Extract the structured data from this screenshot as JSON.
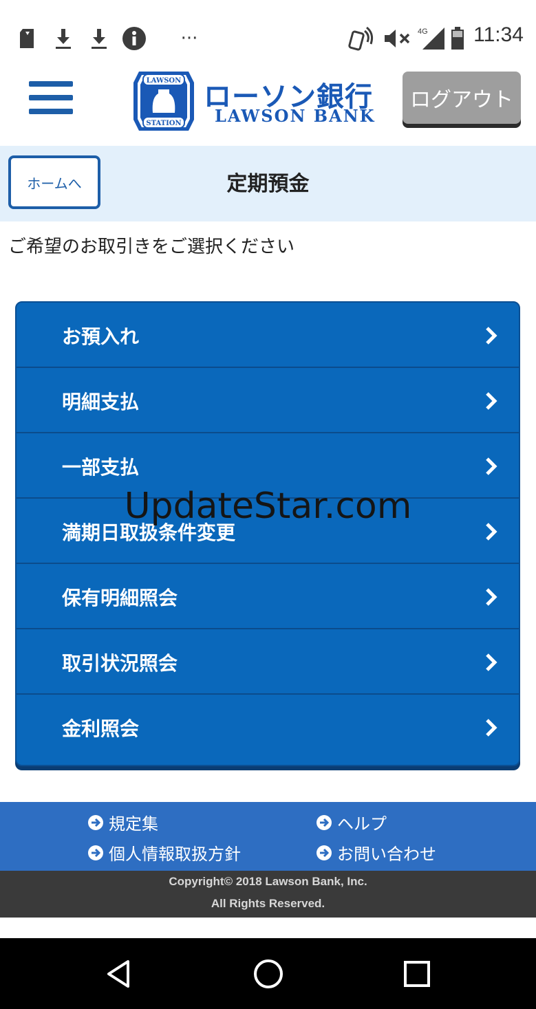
{
  "status_bar": {
    "time": "11:34",
    "network": "4G",
    "left_icons": [
      "sim-icon",
      "download-icon",
      "download-icon",
      "info-icon",
      "more-icon"
    ],
    "right_icons": [
      "nfc-icon",
      "mute-icon",
      "signal-icon",
      "battery-icon"
    ]
  },
  "header": {
    "logo_mark_top": "LAWSON",
    "logo_mark_bottom": "STATION",
    "logo_jp": "ローソン銀行",
    "logo_en": "LAWSON BANK",
    "logout_label": "ログアウト"
  },
  "titlebar": {
    "home_label": "ホームへ",
    "title": "定期預金"
  },
  "instruction": "ご希望のお取引きをご選択ください",
  "menu": [
    {
      "label": "お預入れ"
    },
    {
      "label": "明細支払"
    },
    {
      "label": "一部支払"
    },
    {
      "label": "満期日取扱条件変更"
    },
    {
      "label": "保有明細照会"
    },
    {
      "label": "取引状況照会"
    },
    {
      "label": "金利照会"
    }
  ],
  "watermark": "UpdateStar.com",
  "footer": {
    "links": [
      "規定集",
      "ヘルプ",
      "個人情報取扱方針",
      "お問い合わせ"
    ],
    "copyright_line1": "Copyright© 2018 Lawson Bank, Inc.",
    "copyright_line2": "All Rights Reserved."
  },
  "colors": {
    "brand_blue": "#1a59b6",
    "menu_blue": "#0a68bb",
    "footer_blue": "#2e6ec2",
    "titlebar_bg": "#e3f0fb"
  }
}
